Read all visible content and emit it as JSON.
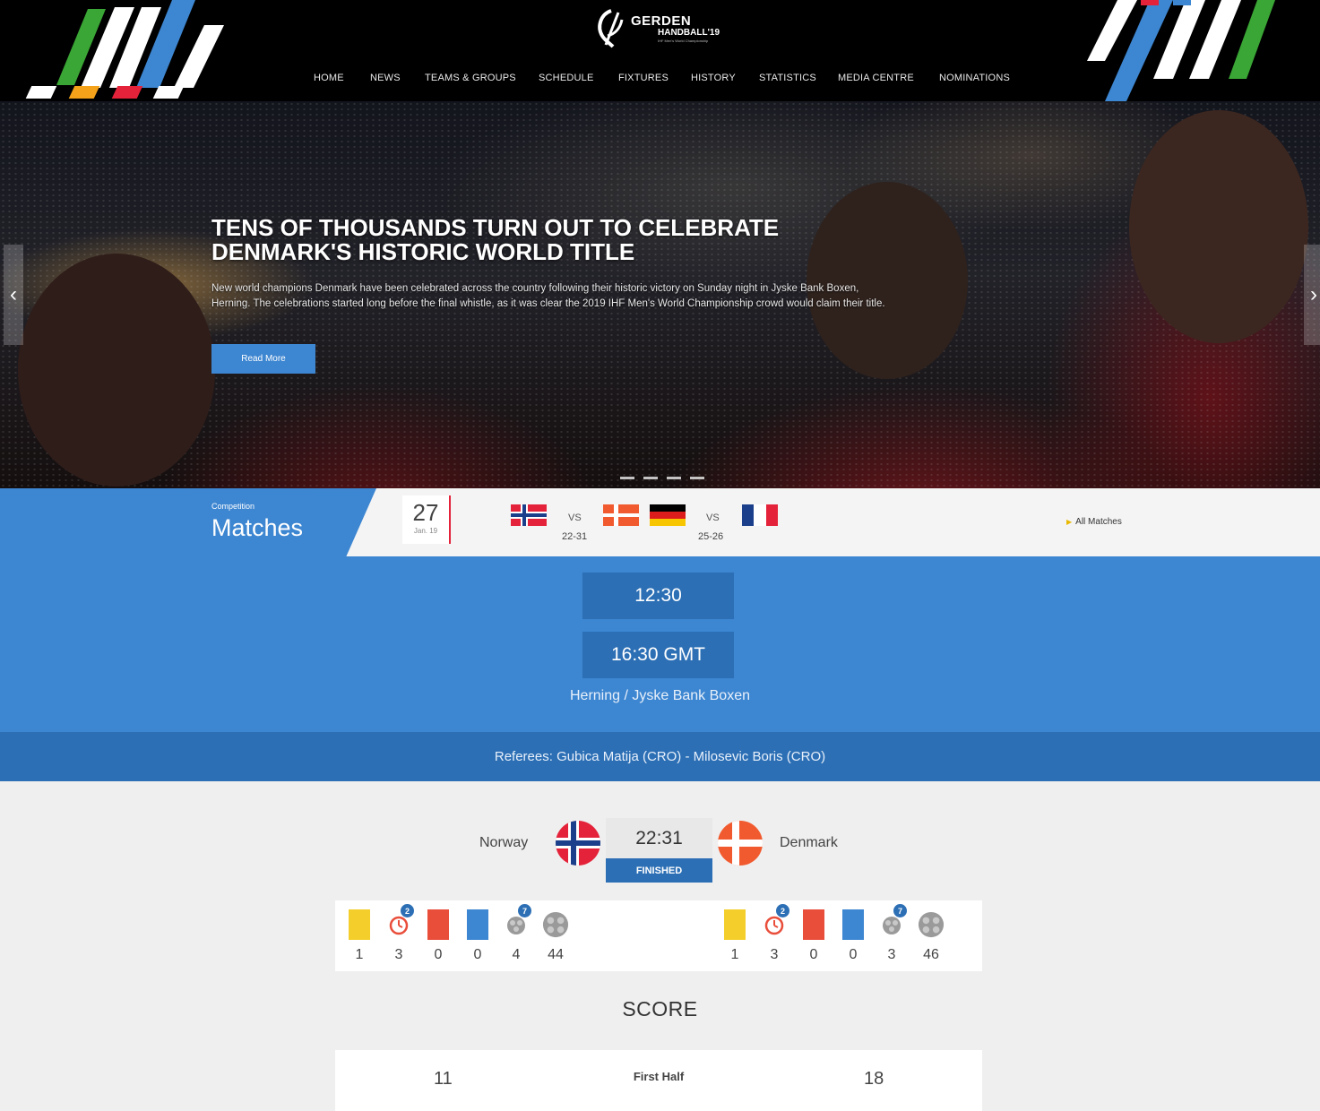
{
  "header": {
    "logo": {
      "line1": "GERDEN",
      "line2": "HANDBALL'19",
      "tagline": "IHF Men's World Championship"
    },
    "nav": [
      "HOME",
      "NEWS",
      "TEAMS & GROUPS",
      "SCHEDULE",
      "FIXTURES",
      "HISTORY",
      "STATISTICS",
      "MEDIA CENTRE",
      "NOMINATIONS"
    ]
  },
  "hero": {
    "title_line1": "TENS OF THOUSANDS TURN OUT TO CELEBRATE",
    "title_line2": "DENMARK'S HISTORIC WORLD TITLE",
    "description": "New world champions Denmark have been celebrated across the country following their historic victory on Sunday night in Jyske Bank Boxen, Herning. The celebrations started long before the final whistle, as it was clear the 2019 IHF Men's World Championship crowd would claim their title.",
    "button_label": "Read More",
    "slides": 4,
    "active_slide": 1
  },
  "matches_strip": {
    "competition_label": "Competition",
    "title": "Matches",
    "date_day": "27",
    "date_month": "Jan. 19",
    "games": [
      {
        "home": "Norway",
        "away": "Denmark",
        "vs": "VS",
        "score": "22-31"
      },
      {
        "home": "Germany",
        "away": "France",
        "vs": "VS",
        "score": "25-26"
      }
    ],
    "all_matches_label": "All Matches"
  },
  "match_info": {
    "local_time": "12:30",
    "gmt_time": "16:30 GMT",
    "venue": "Herning / Jyske Bank Boxen",
    "referees": "Referees: Gubica Matija (CRO) - Milosevic Boris (CRO)"
  },
  "scoreboard": {
    "home_team": "Norway",
    "away_team": "Denmark",
    "score": "22:31",
    "status": "FINISHED",
    "home_stats": [
      "1",
      "3",
      "0",
      "0",
      "4",
      "44"
    ],
    "away_stats": [
      "1",
      "3",
      "0",
      "0",
      "3",
      "46"
    ],
    "suspension_badge": "2",
    "shots_badge": "7"
  },
  "score_section": {
    "heading": "SCORE",
    "periods": [
      {
        "label": "First Half",
        "home": "11",
        "away": "18"
      }
    ]
  },
  "colors": {
    "accent_blue": "#3d86d1",
    "dark_blue": "#2c6fb5",
    "red_accent": "#e4233a",
    "header_bg": "#000000"
  },
  "icons": [
    "chevron-left-icon",
    "chevron-right-icon",
    "yellow-card-icon",
    "suspension-icon",
    "red-card-icon",
    "blue-card-icon",
    "goals-badge-icon",
    "ball-icon"
  ]
}
